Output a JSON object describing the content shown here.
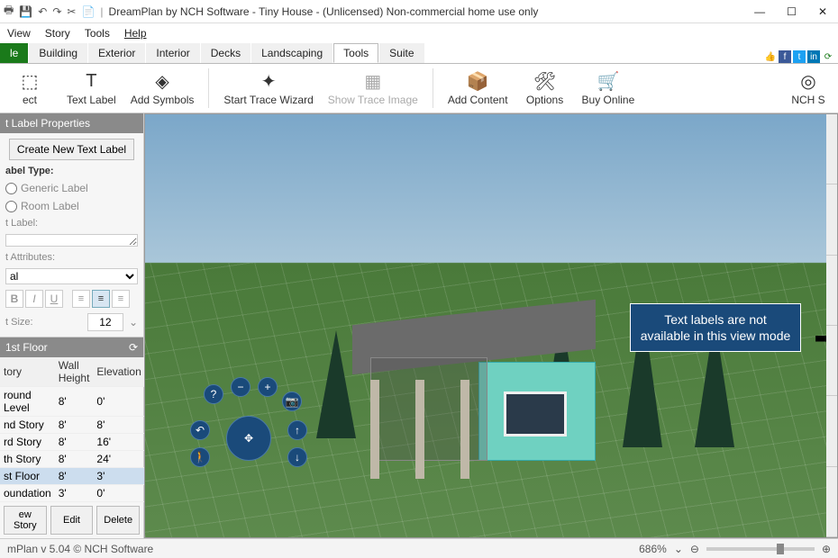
{
  "title": "DreamPlan by NCH Software - Tiny House - (Unlicensed) Non-commercial home use only",
  "menu": [
    "View",
    "Story",
    "Tools",
    "Help"
  ],
  "tabs": [
    "le",
    "Building",
    "Exterior",
    "Interior",
    "Decks",
    "Landscaping",
    "Tools",
    "Suite"
  ],
  "active_tab": "Tools",
  "ribbon": {
    "select_label": "ect",
    "textlabel": "Text Label",
    "addsymbols": "Add Symbols",
    "starttrace": "Start Trace Wizard",
    "showtrace": "Show Trace Image",
    "addcontent": "Add Content",
    "options": "Options",
    "buyonline": "Buy Online",
    "nchs": "NCH S"
  },
  "panel": {
    "title": "t Label Properties",
    "create_btn": "Create New Text Label",
    "labeltype_hd": "abel Type:",
    "generic": "Generic Label",
    "room": "Room Label",
    "textlabel_hd": "t Label:",
    "attrs_hd": "t Attributes:",
    "font": "al",
    "size_hd": "t Size:",
    "size": "12"
  },
  "floors": {
    "title": "1st Floor",
    "cols": [
      "tory",
      "Wall Height",
      "Elevation"
    ],
    "rows": [
      {
        "n": "round Level",
        "h": "8'",
        "e": "0'"
      },
      {
        "n": "nd Story",
        "h": "8'",
        "e": "8'"
      },
      {
        "n": "rd Story",
        "h": "8'",
        "e": "16'"
      },
      {
        "n": "th Story",
        "h": "8'",
        "e": "24'"
      },
      {
        "n": "st Floor",
        "h": "8'",
        "e": "3'",
        "sel": true
      },
      {
        "n": "oundation",
        "h": "3'",
        "e": "0'"
      }
    ],
    "buttons": [
      "ew Story",
      "Edit",
      "Delete"
    ]
  },
  "notice": "Text labels are not available in this view mode",
  "status": {
    "left": "mPlan v 5.04 © NCH Software",
    "zoom": "686%"
  }
}
